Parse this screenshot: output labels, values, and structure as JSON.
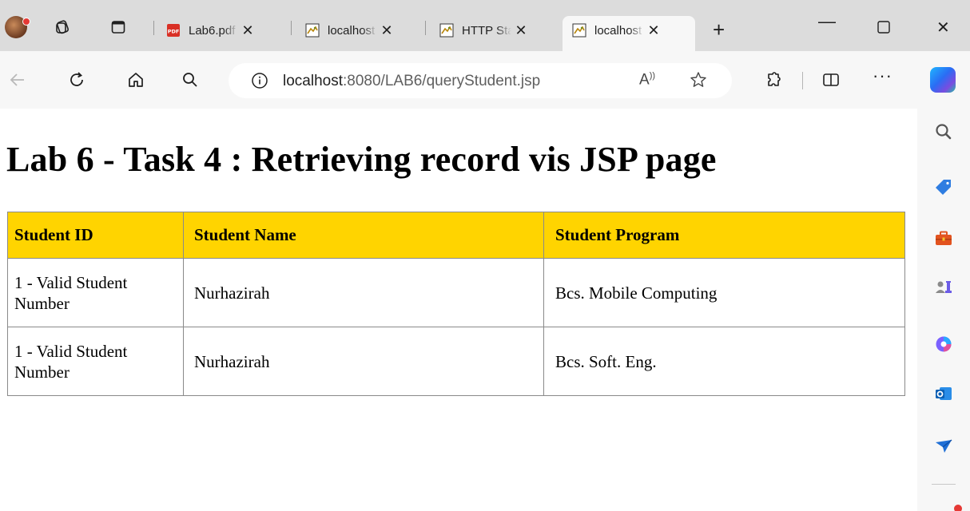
{
  "browser": {
    "tabs": [
      {
        "title": "Lab6.pdf",
        "favicon": "pdf-icon",
        "active": false
      },
      {
        "title": "localhost",
        "favicon": "tomcat-icon",
        "active": false
      },
      {
        "title": "HTTP Status",
        "favicon": "tomcat-icon",
        "active": false
      },
      {
        "title": "localhost",
        "favicon": "tomcat-icon",
        "active": true
      }
    ],
    "close_glyph": "✕",
    "new_tab_glyph": "+",
    "address": {
      "host": "localhost",
      "rest": ":8080/LAB6/queryStudent.jsp"
    },
    "read_aloud_glyph": "A",
    "more_glyph": "···"
  },
  "page": {
    "title": "Lab 6 - Task 4 : Retrieving record vis JSP page",
    "table": {
      "header_color": "#ffd400",
      "columns": [
        "Student ID",
        "Student Name",
        "Student Program"
      ],
      "rows": [
        {
          "id": "1 - Valid Student Number",
          "name": "Nurhazirah",
          "program": "Bcs. Mobile Computing"
        },
        {
          "id": "1 - Valid Student Number",
          "name": "Nurhazirah",
          "program": "Bcs. Soft. Eng."
        }
      ]
    }
  },
  "sidebar": {
    "items": [
      "search-icon",
      "tag-icon",
      "briefcase-icon",
      "games-icon",
      "office-icon",
      "outlook-icon",
      "send-icon"
    ]
  }
}
